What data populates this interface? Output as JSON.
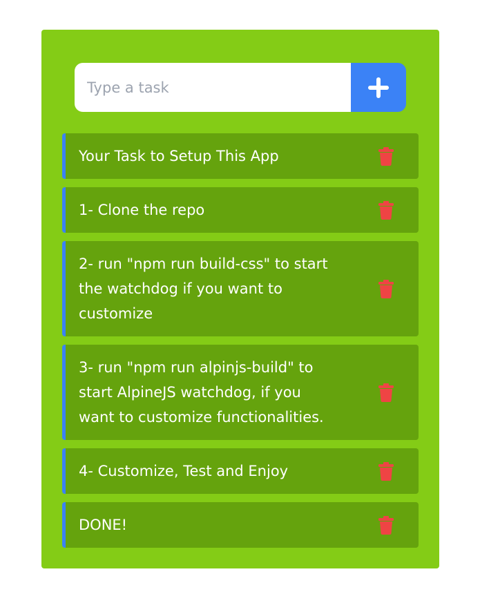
{
  "input": {
    "placeholder": "Type a task",
    "value": ""
  },
  "add_button": {
    "icon": "plus-icon"
  },
  "tasks": [
    {
      "text": "Your Task to Setup This App"
    },
    {
      "text": "1- Clone the repo"
    },
    {
      "text": "2- run \"npm run build-css\" to start the watchdog if you want to customize"
    },
    {
      "text": "3- run \"npm run alpinjs-build\" to start AlpineJS watchdog, if you want to customize functionalities."
    },
    {
      "text": "4- Customize, Test and Enjoy"
    },
    {
      "text": "DONE!"
    }
  ],
  "delete_icon": "trash-icon",
  "colors": {
    "card_background": "#84cc16",
    "task_background": "#65a30d",
    "accent": "#3b82f6",
    "delete": "#ef4444"
  }
}
